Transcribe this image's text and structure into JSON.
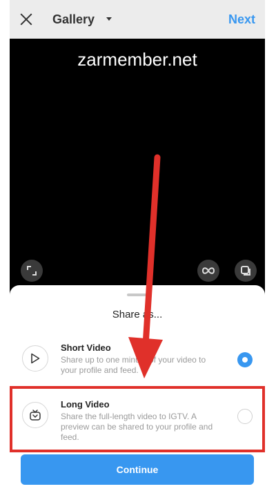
{
  "topbar": {
    "close_icon": "close-icon",
    "title": "Gallery",
    "dropdown_icon": "caret-down-icon",
    "next_label": "Next"
  },
  "preview": {
    "watermark": "zarmember.net",
    "controls": [
      "expand-icon",
      "boomerang-icon",
      "layout-icon"
    ]
  },
  "sheet": {
    "title": "Share as...",
    "options": [
      {
        "icon": "play-icon",
        "title": "Short Video",
        "description": "Share up to one minute of your video to your profile and feed.",
        "selected": true
      },
      {
        "icon": "igtv-icon",
        "title": "Long Video",
        "description": "Share the full-length video to IGTV. A preview can be shared to your profile and feed.",
        "selected": false
      }
    ],
    "continue_label": "Continue"
  },
  "colors": {
    "accent": "#3897f0",
    "annotation": "#e0302a",
    "preview_bg": "#000000"
  }
}
